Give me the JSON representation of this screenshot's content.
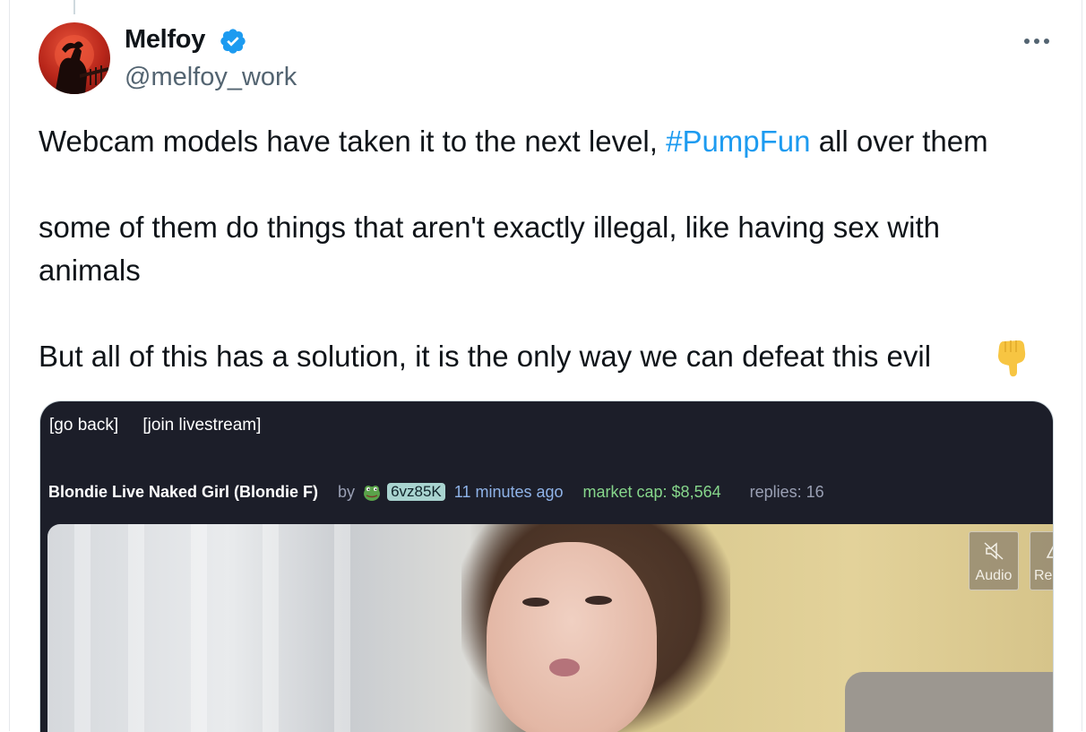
{
  "author": {
    "display_name": "Melfoy",
    "handle": "@melfoy_work",
    "verified": true,
    "avatar_icon": "avatar"
  },
  "more_icon": "more-horizontal-icon",
  "tweet": {
    "line1_before": "Webcam models have taken it to the next level, ",
    "hashtag": "#PumpFun",
    "line1_after": " all over them",
    "line2": "some of them do things that aren't exactly illegal, like having sex with",
    "line3": "animals",
    "line4": "But all of this has a solution, it is the only way we can defeat this evil",
    "emoji": "backhand-pointing-down-emoji"
  },
  "media": {
    "go_back": "[go back]",
    "join_livestream": "[join livestream]",
    "stream_title": "Blondie Live Naked Girl (Blondie F)",
    "by_label": "by",
    "creator_badge": "6vz85K",
    "time_ago": "11 minutes ago",
    "market_cap": "market cap: $8,564",
    "replies": "replies: 16",
    "video_buttons": {
      "audio": "Audio",
      "second_partial": "Re"
    }
  },
  "colors": {
    "link": "#1d9bf0",
    "verified_badge": "#1d9bf0",
    "media_bg": "#1c1e29",
    "market_cap": "#86d68b",
    "time": "#8fb3e8"
  }
}
